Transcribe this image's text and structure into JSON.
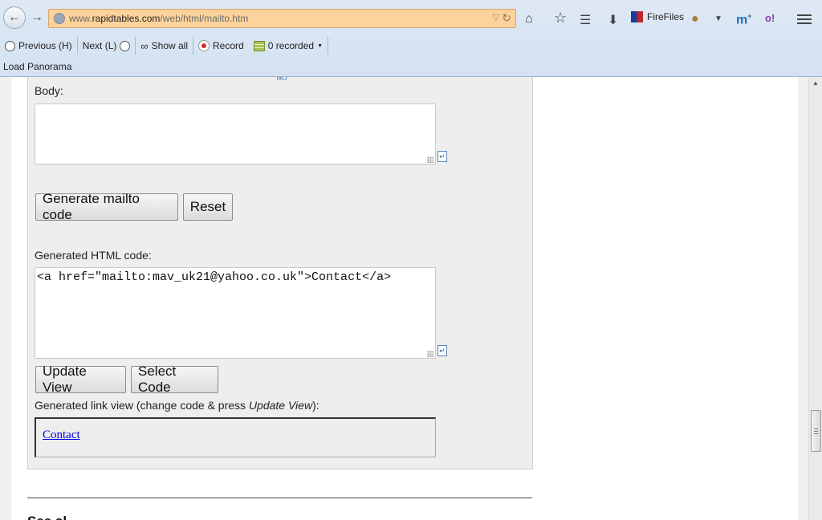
{
  "browser": {
    "url_prefix": "www.",
    "url_domain": "rapidtables.com",
    "url_path": "/web/html/mailto.htm",
    "addon_firefiles": "FireFiles",
    "toolbar": {
      "previous": "Previous (H)",
      "next": "Next (L)",
      "show_all": "Show all",
      "record": "Record",
      "recorded": "0 recorded"
    },
    "load_panorama": "Load Panorama"
  },
  "form": {
    "body_label": "Body:",
    "body_value": "",
    "generate_button": "Generate mailto code",
    "reset_button": "Reset",
    "generated_code_label": "Generated HTML code:",
    "generated_code": "<a href=\"mailto:mav_uk21@yahoo.co.uk\">Contact</a>",
    "update_view_button": "Update View",
    "select_code_button": "Select Code",
    "link_view_label_prefix": "Generated link view (change code & press ",
    "link_view_label_em": "Update View",
    "link_view_label_suffix": "):",
    "link_text": "Contact"
  },
  "next_section_heading": "See al"
}
